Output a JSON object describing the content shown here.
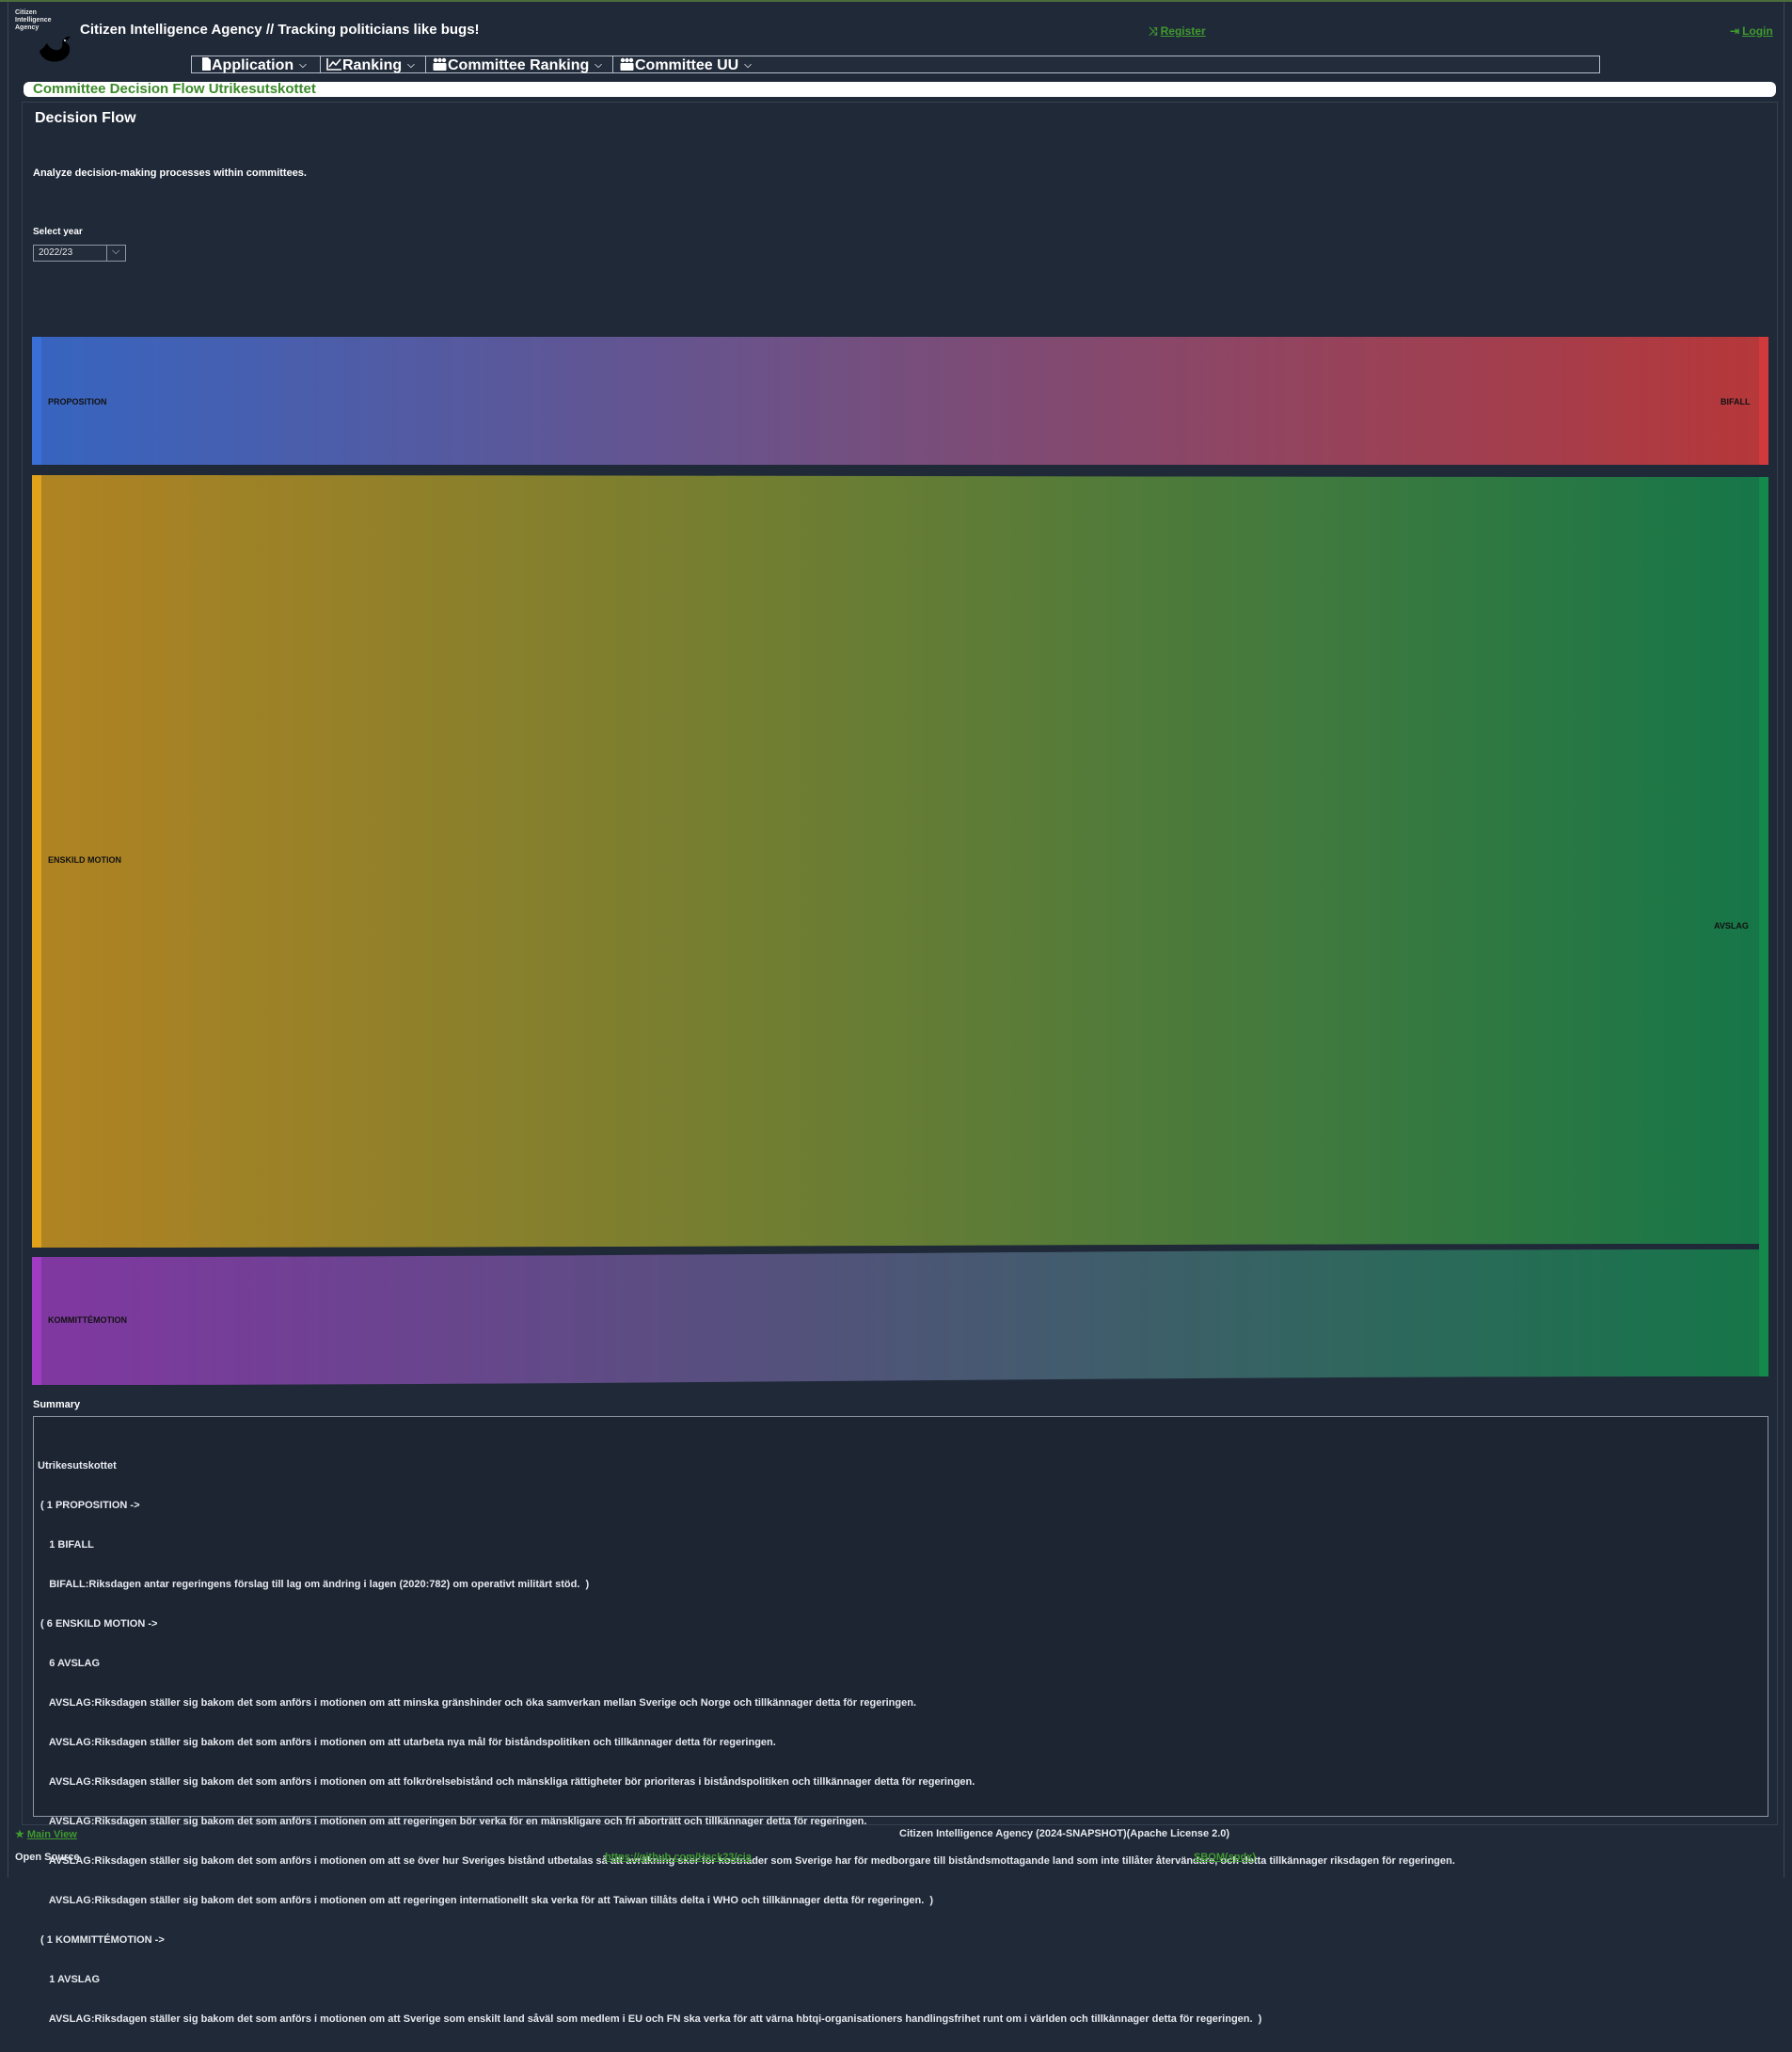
{
  "header": {
    "logo_text": "Citizen Intelligence Agency",
    "title": "Citizen Intelligence Agency  // Tracking politicians like bugs!",
    "register": "Register",
    "login": "Login"
  },
  "menu": {
    "items": [
      {
        "label": "Application",
        "icon": "document-icon"
      },
      {
        "label": "Ranking",
        "icon": "line-chart-icon"
      },
      {
        "label": "Committee Ranking",
        "icon": "group-icon"
      },
      {
        "label": "Committee UU",
        "icon": "group-icon"
      }
    ]
  },
  "view": {
    "title": "Committee Decision Flow Utrikesutskottet",
    "section_title": "Decision Flow",
    "description": "Analyze decision-making processes within committees.",
    "year_label": "Select year",
    "year_value": "2022/23"
  },
  "chart_data": {
    "type": "sankey",
    "nodes": [
      {
        "name": "PROPOSITION",
        "color": "#3b6fd8"
      },
      {
        "name": "ENSKILD MOTION",
        "color": "#e0a11b"
      },
      {
        "name": "KOMMITTÉMOTION",
        "color": "#a03cc4"
      },
      {
        "name": "BIFALL",
        "color": "#d03a3a"
      },
      {
        "name": "AVSLAG",
        "color": "#13894c"
      }
    ],
    "links": [
      {
        "source": "PROPOSITION",
        "target": "BIFALL",
        "value": 1
      },
      {
        "source": "ENSKILD MOTION",
        "target": "AVSLAG",
        "value": 6
      },
      {
        "source": "KOMMITTÉMOTION",
        "target": "AVSLAG",
        "value": 1
      }
    ]
  },
  "summary": {
    "label": "Summary",
    "lines": [
      "Utrikesutskottet",
      " ( 1 PROPOSITION ->",
      "    1 BIFALL",
      "    BIFALL:Riksdagen antar regeringens förslag till lag om ändring i lagen (2020:782) om operativt militärt stöd.  )",
      " ( 6 ENSKILD MOTION ->",
      "    6 AVSLAG",
      "    AVSLAG:Riksdagen ställer sig bakom det som anförs i motionen om att minska gränshinder och öka samverkan mellan Sverige och Norge och tillkännager detta för regeringen.",
      "    AVSLAG:Riksdagen ställer sig bakom det som anförs i motionen om att utarbeta nya mål för biståndspolitiken och tillkännager detta för regeringen.",
      "    AVSLAG:Riksdagen ställer sig bakom det som anförs i motionen om att folkrörelsebistånd och mänskliga rättigheter bör prioriteras i biståndspolitiken och tillkännager detta för regeringen.",
      "    AVSLAG:Riksdagen ställer sig bakom det som anförs i motionen om att regeringen bör verka för en mänskligare och fri aborträtt och tillkännager detta för regeringen.",
      "    AVSLAG:Riksdagen ställer sig bakom det som anförs i motionen om att se över hur Sveriges bistånd utbetalas så att avräkning sker för kostnader som Sverige har för medborgare till biståndsmottagande land som inte tillåter återvändare, och detta tillkännager riksdagen för regeringen.",
      "    AVSLAG:Riksdagen ställer sig bakom det som anförs i motionen om att regeringen internationellt ska verka för att Taiwan tillåts delta i WHO och tillkännager detta för regeringen.  )",
      " ( 1 KOMMITTÉMOTION ->",
      "    1 AVSLAG",
      "    AVSLAG:Riksdagen ställer sig bakom det som anförs i motionen om att Sverige som enskilt land såväl som medlem i EU och FN ska verka för att värna hbtqi-organisationers handlingsfrihet runt om i världen och tillkännager detta för regeringen.  )"
    ]
  },
  "footer": {
    "main_view": "Main View",
    "copyright": "Citizen Intelligence Agency (2024-SNAPSHOT)(Apache License 2.0)",
    "open_source": "Open Source",
    "github": "https://github.com/Hack23/cia",
    "sbom": "SBOM(spdx)"
  }
}
